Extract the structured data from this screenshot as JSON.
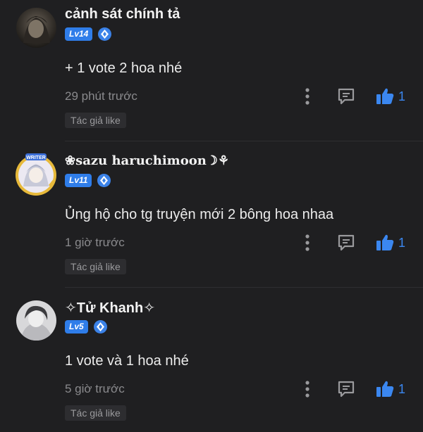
{
  "comments": [
    {
      "author": "cảnh sát chính tả",
      "level": "Lv14",
      "content": "+ 1 vote 2 hoa nhé",
      "time": "29 phút trước",
      "likes": "1",
      "badge": "Tác giả like"
    },
    {
      "author": "❀sazu haruchimoon☽⚘",
      "level": "Lv11",
      "avatar_text": "WRITER",
      "content": "Ủng hộ cho tg truyện mới 2 bông hoa nhaa",
      "time": "1 giờ trước",
      "likes": "1",
      "badge": "Tác giả like"
    },
    {
      "author": "✧Tử Khanh✧",
      "level": "Lv5",
      "content": "1 vote và 1 hoa nhé",
      "time": "5 giờ trước",
      "likes": "1",
      "badge": "Tác giả like"
    }
  ],
  "colors": {
    "background": "#1f1f21",
    "accent": "#2f7de9",
    "like": "#3b87f0"
  }
}
